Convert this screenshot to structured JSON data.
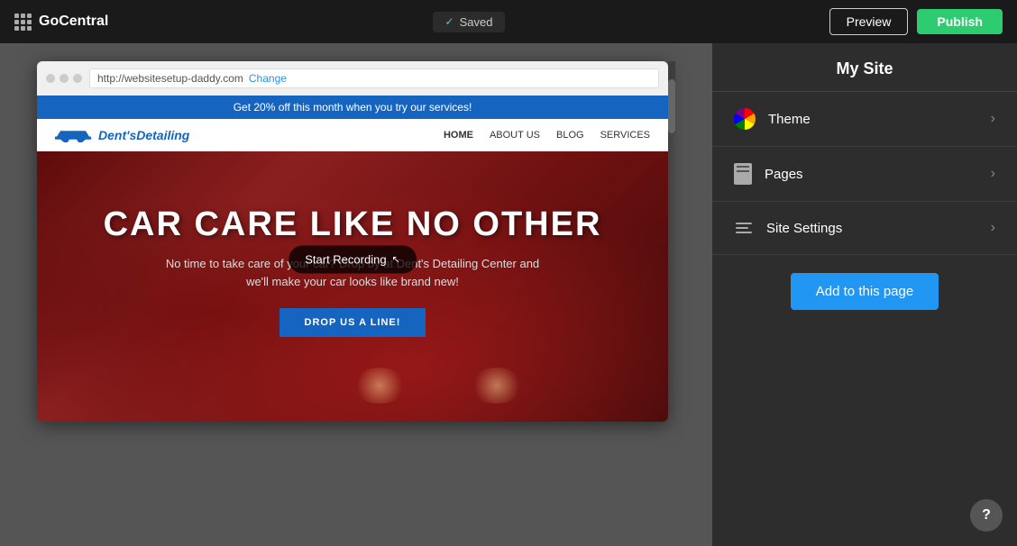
{
  "topBar": {
    "brandName": "GoCentral",
    "savedLabel": "Saved",
    "previewLabel": "Preview",
    "publishLabel": "Publish"
  },
  "browser": {
    "url": "http://websitesetup-daddy.com",
    "changeLabel": "Change"
  },
  "site": {
    "banner": "Get 20% off this month when you try our services!",
    "logoText": "Dent's",
    "logoText2": "Detailing",
    "navLinks": [
      "HOME",
      "ABOUT US",
      "BLOG",
      "SERVICES"
    ],
    "heroTitle": "CAR CARE LIKE NO OTHER",
    "heroSubtitle": "No time to take care of your car? Drop by at Dent's Detailing Center and we'll make your car looks like brand new!",
    "heroCta": "DROP US A LINE!"
  },
  "recording": {
    "label": "Start Recording"
  },
  "rightPanel": {
    "title": "My Site",
    "menuItems": [
      {
        "id": "theme",
        "label": "Theme"
      },
      {
        "id": "pages",
        "label": "Pages"
      },
      {
        "id": "settings",
        "label": "Site Settings"
      }
    ],
    "addToPageLabel": "Add to this page"
  },
  "help": {
    "label": "?"
  }
}
